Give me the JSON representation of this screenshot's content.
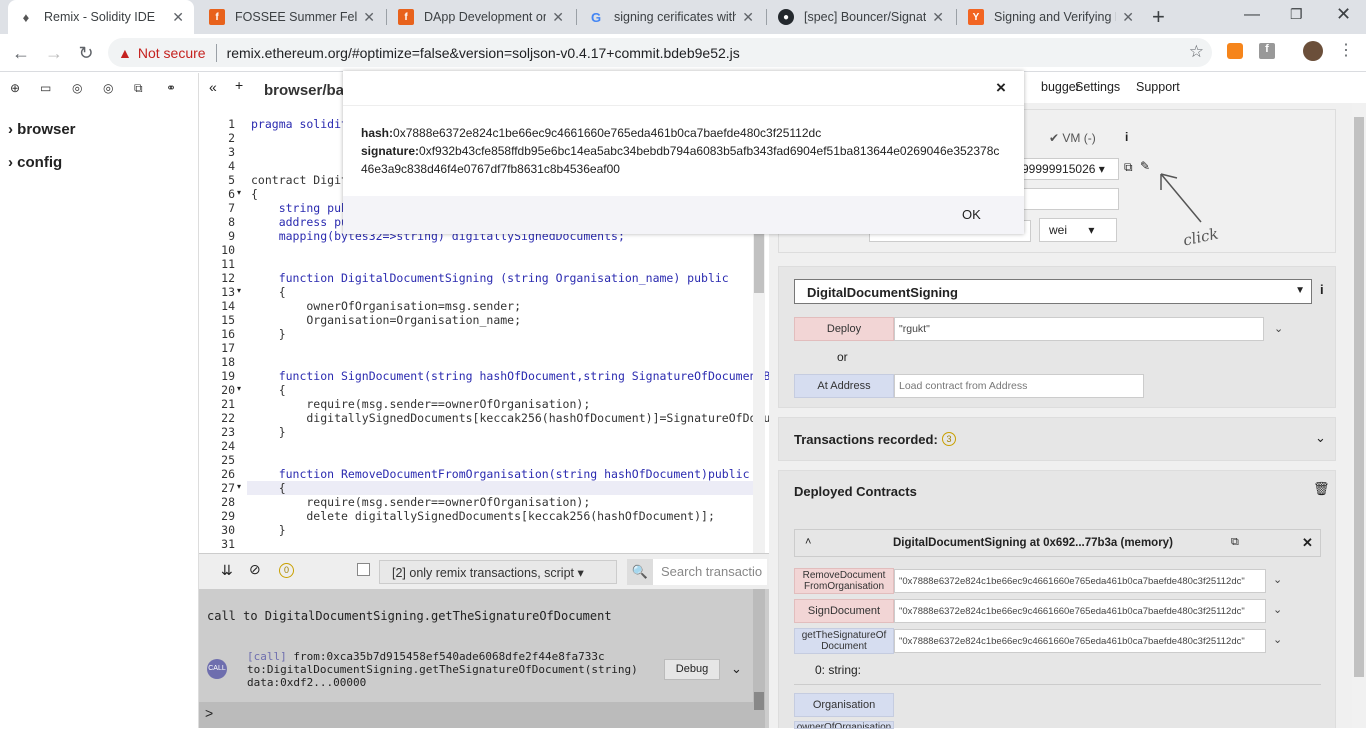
{
  "browser": {
    "tabs": [
      {
        "title": "Remix - Solidity IDE",
        "icon": "ethereum-icon",
        "color": "#555555"
      },
      {
        "title": "FOSSEE Summer Fellow",
        "icon": "fossee-icon",
        "color": "#e8621c"
      },
      {
        "title": "DApp Development on",
        "icon": "fossee-icon",
        "color": "#e8621c"
      },
      {
        "title": "signing cerificates with",
        "icon": "google-icon",
        "color": "#4285f4"
      },
      {
        "title": "[spec] Bouncer/Signatu",
        "icon": "github-icon",
        "color": "#24292e"
      },
      {
        "title": "Signing and Verifying E",
        "icon": "ycombinator-icon",
        "color": "#f26522"
      }
    ],
    "new_tab": "+",
    "not_secure": "Not secure",
    "url": "remix.ethereum.org/#optimize=false&version=soljson-v0.4.17+commit.bdeb9e52.js"
  },
  "file_explorer": {
    "items": [
      "browser",
      "config"
    ]
  },
  "editor": {
    "tab_title": "browser/ba",
    "lines": [
      {
        "n": "1",
        "text": "pragma solidit"
      },
      {
        "n": "2",
        "text": ""
      },
      {
        "n": "3",
        "text": ""
      },
      {
        "n": "4",
        "text": ""
      },
      {
        "n": "5",
        "text": "contract Digit"
      },
      {
        "n": "6",
        "text": "{"
      },
      {
        "n": "7",
        "text": "    string pub"
      },
      {
        "n": "8",
        "text": "    address pu"
      },
      {
        "n": "9",
        "text": "    mapping(bytes32=>string) digitallySignedDocuments;"
      },
      {
        "n": "10",
        "text": ""
      },
      {
        "n": "11",
        "text": ""
      },
      {
        "n": "12",
        "text": "    function DigitalDocumentSigning (string Organisation_name) public"
      },
      {
        "n": "13",
        "text": "    {"
      },
      {
        "n": "14",
        "text": "        ownerOfOrganisation=msg.sender;"
      },
      {
        "n": "15",
        "text": "        Organisation=Organisation_name;"
      },
      {
        "n": "16",
        "text": "    }"
      },
      {
        "n": "17",
        "text": ""
      },
      {
        "n": "18",
        "text": ""
      },
      {
        "n": "19",
        "text": "    function SignDocument(string hashOfDocument,string SignatureOfDocumentBy"
      },
      {
        "n": "20",
        "text": "    {"
      },
      {
        "n": "21",
        "text": "        require(msg.sender==ownerOfOrganisation);"
      },
      {
        "n": "22",
        "text": "        digitallySignedDocuments[keccak256(hashOfDocument)]=SignatureOfDocum"
      },
      {
        "n": "23",
        "text": "    }"
      },
      {
        "n": "24",
        "text": ""
      },
      {
        "n": "25",
        "text": ""
      },
      {
        "n": "26",
        "text": "    function RemoveDocumentFromOrganisation(string hashOfDocument)public"
      },
      {
        "n": "27",
        "text": "    {"
      },
      {
        "n": "28",
        "text": "        require(msg.sender==ownerOfOrganisation);"
      },
      {
        "n": "29",
        "text": "        delete digitallySignedDocuments[keccak256(hashOfDocument)];"
      },
      {
        "n": "30",
        "text": "    }"
      },
      {
        "n": "31",
        "text": ""
      }
    ]
  },
  "terminal": {
    "count": "0",
    "filter": "[2] only remix transactions, script",
    "search_placeholder": "Search transactio",
    "call_line": "call to DigitalDocumentSigning.getTheSignatureOfDocument",
    "badge": "CALL",
    "log_tag": "[call]",
    "log_from": "from:0xca35b7d915458ef540ade6068dfe2f44e8fa733c",
    "log_to": "to:DigitalDocumentSigning.getTheSignatureOfDocument(string)",
    "log_data": "data:0xdf2...00000",
    "debug": "Debug",
    "prompt": ">"
  },
  "top_menu": {
    "items": [
      "bugger",
      "Settings",
      "Support"
    ]
  },
  "run_tab": {
    "environment": "VM (-)",
    "account_balance": "99999915026",
    "unit": "wei",
    "annotation": "click",
    "contract_select": "DigitalDocumentSigning",
    "deploy": "Deploy",
    "deploy_arg": "\"rgukt\"",
    "or": "or",
    "at_address": "At Address",
    "at_address_placeholder": "Load contract from Address",
    "transactions_recorded": "Transactions recorded:",
    "transactions_count": "3",
    "deployed_contracts": "Deployed Contracts",
    "instance_title": "DigitalDocumentSigning at 0x692...77b3a (memory)",
    "functions": [
      {
        "label": "RemoveDocument FromOrganisation",
        "value": "\"0x7888e6372e824c1be66ec9c4661660e765eda461b0ca7baefde480c3f25112dc\""
      },
      {
        "label": "SignDocument",
        "value": "\"0x7888e6372e824c1be66ec9c4661660e765eda461b0ca7baefde480c3f25112dc\""
      },
      {
        "label": "getTheSignatureOf Document",
        "value": "\"0x7888e6372e824c1be66ec9c4661660e765eda461b0ca7baefde480c3f25112dc\""
      }
    ],
    "output": "0: string:",
    "organisation_btn": "Organisation",
    "partial_btn": "ownerOfOrganisation"
  },
  "modal": {
    "hash_label": "hash:",
    "hash_value": "0x7888e6372e824c1be66ec9c4661660e765eda461b0ca7baefde480c3f25112dc",
    "signature_label": "signature:",
    "signature_value": "0xf932b43cfe858ffdb95e6bc14ea5abc34bebdb794a6083b5afb343fad6904ef51ba813644e0269046e352378c46e3a9c838d46f4e0767df7fb8631c8b4536eaf00",
    "ok": "OK",
    "close": "×"
  }
}
